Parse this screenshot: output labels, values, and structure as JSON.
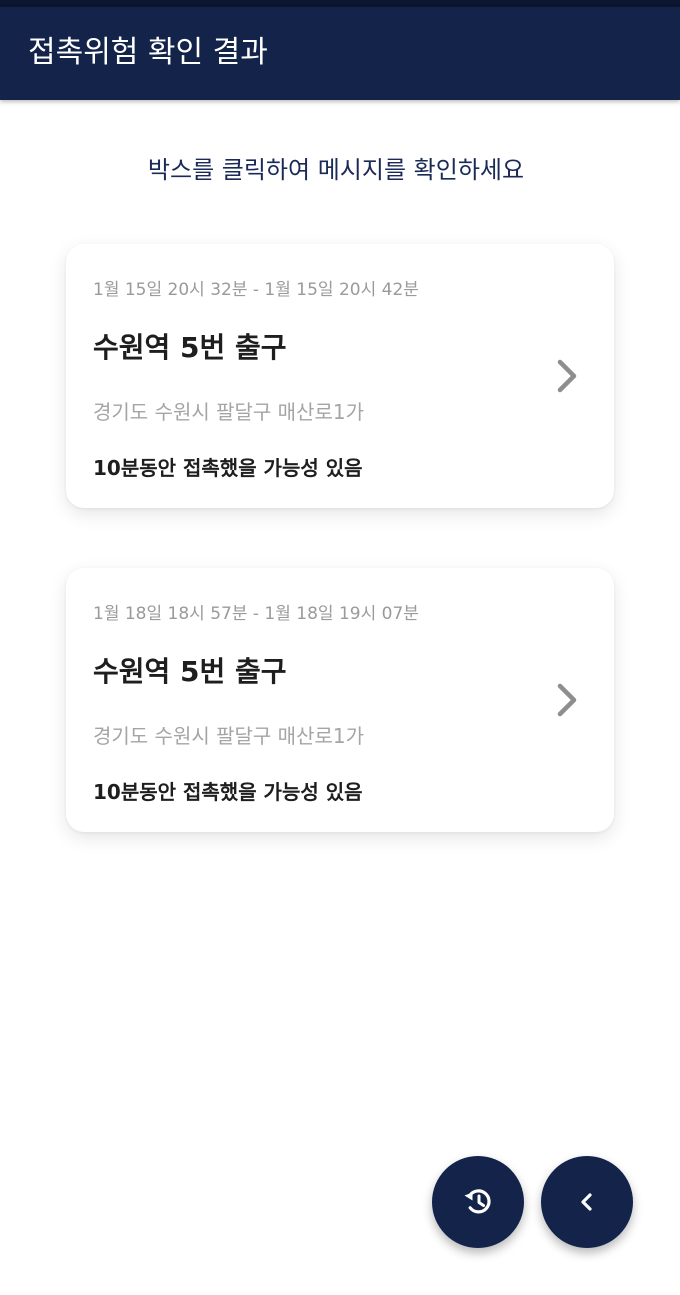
{
  "app_bar": {
    "title": "접촉위험 확인 결과"
  },
  "instruction": "박스를 클릭하여 메시지를 확인하세요",
  "cards": [
    {
      "time_range": "1월 15일 20시 32분 - 1월 15일 20시 42분",
      "place": "수원역 5번 출구",
      "address": "경기도 수원시 팔달구 매산로1가",
      "note": "10분동안 접촉했을 가능성 있음",
      "icon": "chevron-right-icon"
    },
    {
      "time_range": "1월 18일 18시 57분 - 1월 18일 19시 07분",
      "place": "수원역 5번 출구",
      "address": "경기도 수원시 팔달구 매산로1가",
      "note": "10분동안 접촉했을 가능성 있음",
      "icon": "chevron-right-icon"
    }
  ],
  "fabs": {
    "history_icon": "history-icon",
    "back_icon": "chevron-left-icon"
  },
  "colors": {
    "primary": "#13234a",
    "status_bar": "#0d1530",
    "instruction_text": "#1a2a57",
    "muted_text": "#9a9a9a",
    "body_text": "#1e1e1e"
  }
}
